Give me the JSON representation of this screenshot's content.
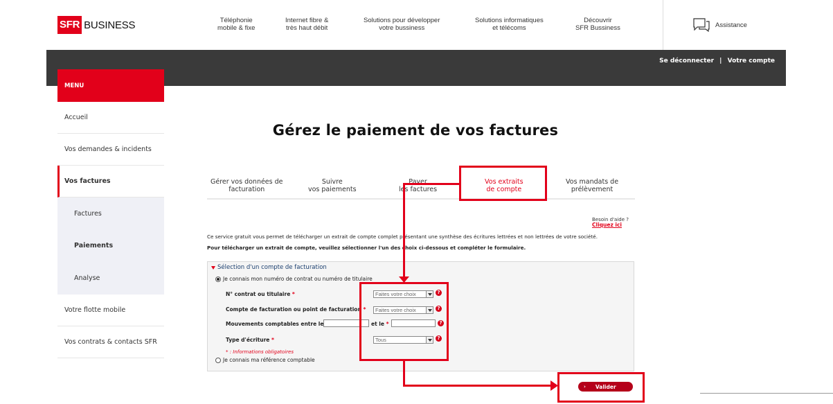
{
  "header": {
    "logo_sfr": "SFR",
    "logo_business": "BUSINESS",
    "nav": [
      {
        "line1": "Téléphonie",
        "line2": "mobile & fixe"
      },
      {
        "line1": "Internet fibre &",
        "line2": "très haut débit"
      },
      {
        "line1": "Solutions pour développer",
        "line2": "votre bussiness"
      },
      {
        "line1": "Solutions informatiques",
        "line2": "et télécoms"
      },
      {
        "line1": "Découvrir",
        "line2": "SFR Bussiness"
      }
    ],
    "assistance": "Assistance"
  },
  "account_bar": {
    "logout": "Se déconnecter",
    "separator": "|",
    "account": "Votre compte"
  },
  "sidebar": {
    "menu_title": "MENU",
    "items": [
      {
        "label": "Accueil"
      },
      {
        "label": "Vos demandes & incidents"
      },
      {
        "label": "Vos factures"
      },
      {
        "label": "Factures"
      },
      {
        "label": "Paiements"
      },
      {
        "label": "Analyse"
      },
      {
        "label": "Votre flotte mobile"
      },
      {
        "label": "Vos contrats & contacts SFR"
      }
    ]
  },
  "main": {
    "title": "Gérez le paiement de vos factures",
    "tabs": [
      {
        "line1": "Gérer vos données de",
        "line2": "facturation"
      },
      {
        "line1": "Suivre",
        "line2": "vos paiements"
      },
      {
        "line1": "Payer",
        "line2": "les factures"
      },
      {
        "line1": "Vos extraits",
        "line2": "de compte"
      },
      {
        "line1": "Vos mandats de",
        "line2": "prélèvement"
      }
    ],
    "help_text": "Besoin d'aide ?",
    "help_link": "Cliquez ici",
    "info_line1": "Ce service gratuit vous permet de télécharger un extrait de compte complet présentant une synthèse des écritures lettrées et non lettrées de votre société.",
    "info_line2": "Pour télécharger un extrait de compte, veuillez sélectionner l'un des choix ci-dessous et compléter le formulaire."
  },
  "form": {
    "section_title": "Sélection d'un compte de facturation",
    "option1": "Je connais mon numéro de contrat ou numéro de titulaire",
    "option2": "Je connais ma référence comptable",
    "fields": {
      "contract_label": "N° contrat ou titulaire",
      "contract_value": "Faites votre choix",
      "billing_label": "Compte de facturation ou point de facturation",
      "billing_value": "Faites votre choix",
      "movements_label": "Mouvements comptables entre le",
      "and_label": "et le",
      "type_label": "Type d'écriture",
      "type_value": "Tous"
    },
    "required_star": "*",
    "help_glyph": "?",
    "required_note": "* : Informations obligatoires",
    "submit_chevron": "›",
    "submit": "Valider"
  },
  "colors": {
    "brand_red": "#e2001a",
    "dark_bar": "#3a3a3a",
    "submenu_bg": "#eff0f6",
    "button_red": "#b5001a"
  }
}
